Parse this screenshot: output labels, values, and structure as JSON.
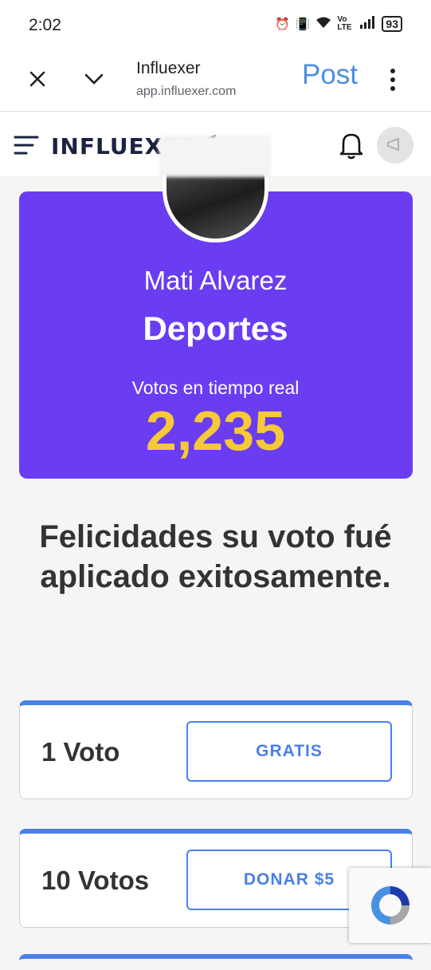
{
  "status": {
    "time": "2:02",
    "signal_label": "Vo LTE",
    "battery": "93"
  },
  "browser": {
    "title": "Influexer",
    "url": "app.influexer.com",
    "action": "Post"
  },
  "app": {
    "logo": "INFLUEXER"
  },
  "profile": {
    "name": "Mati Alvarez",
    "category": "Deportes",
    "votes_label": "Votos en tiempo real",
    "votes_count": "2,235"
  },
  "message": "Felicidades su voto fué aplicado exitosamente.",
  "options": [
    {
      "label": "1 Voto",
      "button": "GRATIS"
    },
    {
      "label": "10 Votos",
      "button": "DONAR $5"
    }
  ],
  "colors": {
    "card": "#6a3cf2",
    "count": "#f5c938",
    "accent": "#4a80e8",
    "post": "#4a90e2"
  },
  "icons": [
    "close-icon",
    "chevron-down-icon",
    "more-vert-icon",
    "menu-icon",
    "bell-icon",
    "megaphone-icon",
    "recaptcha-icon"
  ]
}
